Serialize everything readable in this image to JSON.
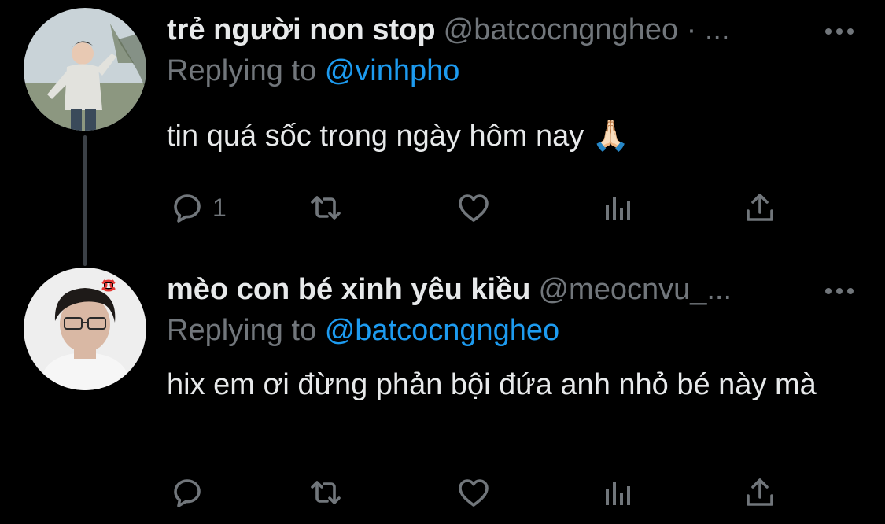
{
  "tweets": [
    {
      "display_name": "trẻ người non stop",
      "handle": "@batcocngngheo · ...",
      "replying_label": "Replying to",
      "replying_to": "@vinhpho",
      "text": "tin quá sốc trong ngày hôm nay 🙏🏻",
      "reply_count": "1",
      "avatar_colors": {
        "sky": "#c9d3d8",
        "tree": "#7a8b6e",
        "jacket": "#e2e2dd",
        "hair": "#2a2522"
      }
    },
    {
      "display_name": "mèo con bé xinh yêu kiều",
      "handle": "@meocnvu_...",
      "replying_label": "Replying to",
      "replying_to": "@batcocngngheo",
      "text": "hix em ơi đừng phản bội đứa anh nhỏ bé này mà",
      "reply_count": "",
      "avatar_colors": {
        "bg": "#eeeeee",
        "hair": "#1e1a18",
        "skin": "#d9b8a4",
        "anger": "#e53935"
      }
    }
  ],
  "icons": {
    "more": "more-horizontal-icon",
    "reply": "reply-bubble-icon",
    "retweet": "retweet-icon",
    "like": "heart-icon",
    "views": "bar-chart-icon",
    "share": "share-upload-icon"
  },
  "colors": {
    "background": "#000000",
    "text": "#e7e9ea",
    "muted": "#71767b",
    "accent": "#1d9bf0",
    "thread_line": "#3b4046"
  }
}
